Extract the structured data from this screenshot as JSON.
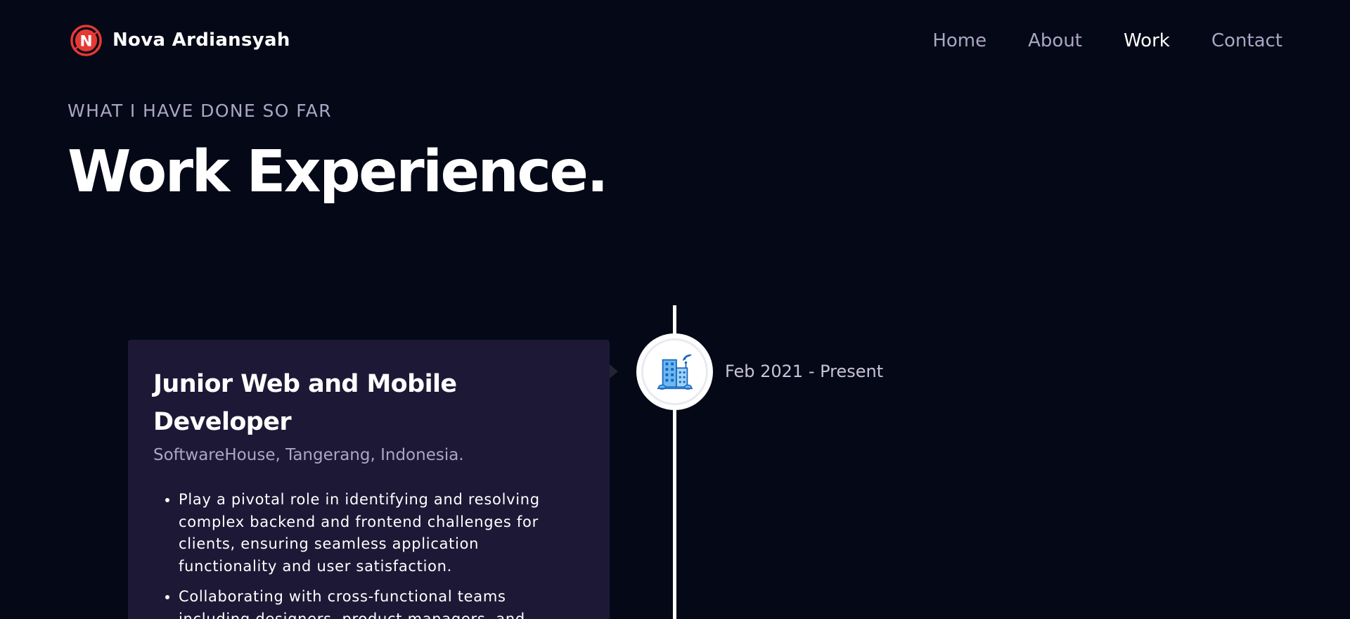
{
  "brand": {
    "name": "Nova  Ardiansyah",
    "logo_letter": "N",
    "logo_color": "#e53935"
  },
  "nav": {
    "items": [
      {
        "label": "Home",
        "active": false
      },
      {
        "label": "About",
        "active": false
      },
      {
        "label": "Work",
        "active": true
      },
      {
        "label": "Contact",
        "active": false
      }
    ]
  },
  "section": {
    "subtitle": "What I have done so far",
    "title": "Work Experience."
  },
  "experience": [
    {
      "role": "Junior Web and Mobile Developer",
      "company": "SoftwareHouse, Tangerang, Indonesia.",
      "date": "Feb 2021 - Present",
      "icon": "office-building-icon",
      "points": [
        "Play a pivotal role in identifying and resolving complex backend and frontend challenges for clients, ensuring seamless application functionality and user satisfaction.",
        "Collaborating with cross-functional teams including designers, product managers, and"
      ]
    }
  ],
  "colors": {
    "background": "#050816",
    "card": "#1d1836",
    "secondary_text": "#aaa6c3",
    "icon_blue": "#3a9be8"
  }
}
